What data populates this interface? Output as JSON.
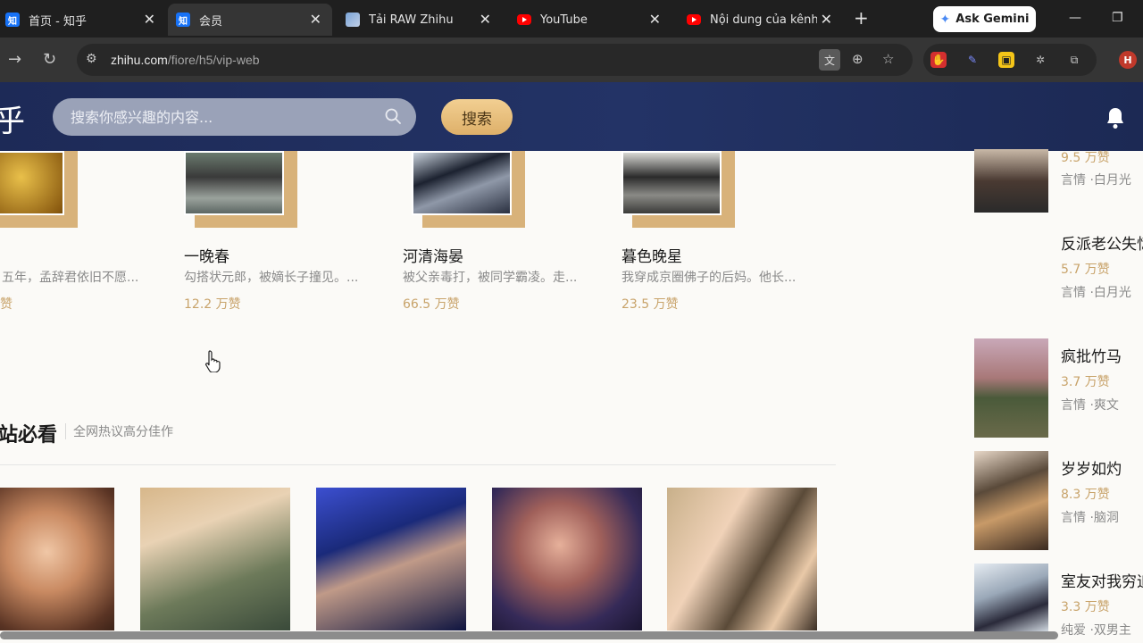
{
  "browser": {
    "tabs": [
      {
        "label": "首页 - 知乎",
        "icon": "zhihu-favicon"
      },
      {
        "label": "会员",
        "icon": "zhihu-favicon"
      },
      {
        "label": "Tải RAW Zhihu",
        "icon": "image-favicon"
      },
      {
        "label": "YouTube",
        "icon": "youtube-favicon"
      },
      {
        "label": "Nội dung của kênh",
        "icon": "youtube-favicon"
      }
    ],
    "gemini_label": "Ask Gemini",
    "url_host": "zhihu.com",
    "url_path": "/fiore/h5/vip-web",
    "profile_initial": "H"
  },
  "header": {
    "logo": "乎",
    "search_placeholder": "搜索你感兴趣的内容...",
    "search_button": "搜索"
  },
  "top_cards": [
    {
      "title": "",
      "desc": "五年，孟辞君依旧不愿...",
      "likes": "赞"
    },
    {
      "title": "一晚春",
      "desc": "勾搭状元郎，被嫡长子撞见。...",
      "likes": "12.2 万赞"
    },
    {
      "title": "河清海晏",
      "desc": "被父亲毒打，被同学霸凌。走...",
      "likes": "66.5 万赞"
    },
    {
      "title": "暮色晚星",
      "desc": "我穿成京圈佛子的后妈。他长...",
      "likes": "23.5 万赞"
    }
  ],
  "section": {
    "title": "站必看",
    "subtitle": "全网热议高分佳作"
  },
  "right_rail": [
    {
      "title": "",
      "likes": "9.5 万赞",
      "tags": "言情 ·白月光"
    },
    {
      "title": "反派老公失忆",
      "likes": "5.7 万赞",
      "tags": "言情 ·白月光"
    },
    {
      "title": "疯批竹马",
      "likes": "3.7 万赞",
      "tags": "言情 ·爽文"
    },
    {
      "title": "岁岁如灼",
      "likes": "8.3 万赞",
      "tags": "言情 ·脑洞"
    },
    {
      "title": "室友对我穷追",
      "likes": "3.3 万赞",
      "tags": "纯爱 ·双男主"
    }
  ],
  "colors": {
    "header_bg": "#1d2a57",
    "accent_gold": "#c8a36a",
    "search_button": "#e9c27f"
  }
}
